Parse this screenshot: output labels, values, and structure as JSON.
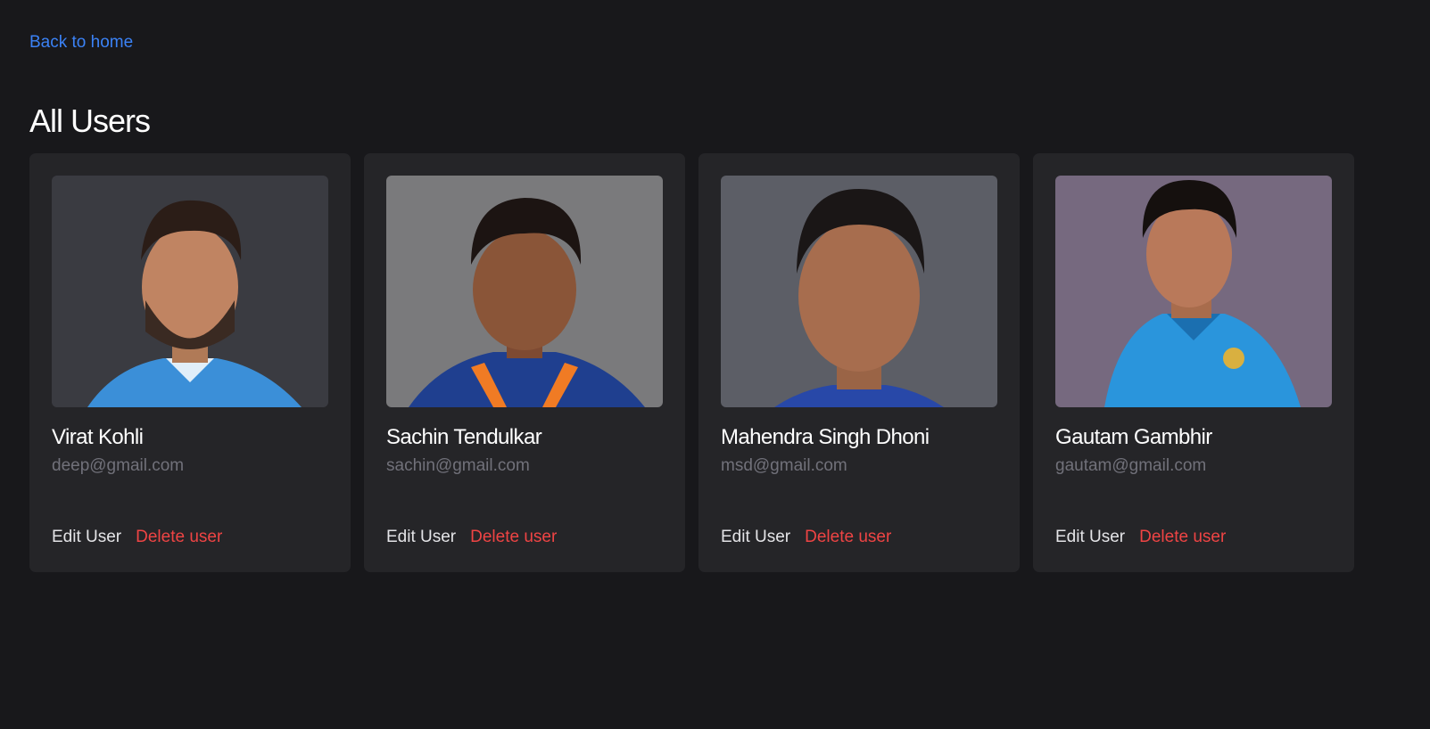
{
  "nav": {
    "back_label": "Back to home"
  },
  "page": {
    "title": "All Users"
  },
  "users": [
    {
      "name": "Virat Kohli",
      "email": "deep@gmail.com",
      "edit_label": "Edit User",
      "delete_label": "Delete user",
      "photo_bg": "#3a3b41",
      "jersey_color": "#3b8fd8"
    },
    {
      "name": "Sachin Tendulkar",
      "email": "sachin@gmail.com",
      "edit_label": "Edit User",
      "delete_label": "Delete user",
      "photo_bg": "#7a7a7c",
      "jersey_color": "#1f3f8f"
    },
    {
      "name": "Mahendra Singh Dhoni",
      "email": "msd@gmail.com",
      "edit_label": "Edit User",
      "delete_label": "Delete user",
      "photo_bg": "#5c5e66",
      "jersey_color": "#2848a8"
    },
    {
      "name": "Gautam Gambhir",
      "email": "gautam@gmail.com",
      "edit_label": "Edit User",
      "delete_label": "Delete user",
      "photo_bg": "#76697f",
      "jersey_color": "#2a95dc"
    }
  ],
  "colors": {
    "background": "#18181b",
    "card": "#252528",
    "link": "#3b82f6",
    "danger": "#ef4444",
    "muted": "#71717a"
  }
}
